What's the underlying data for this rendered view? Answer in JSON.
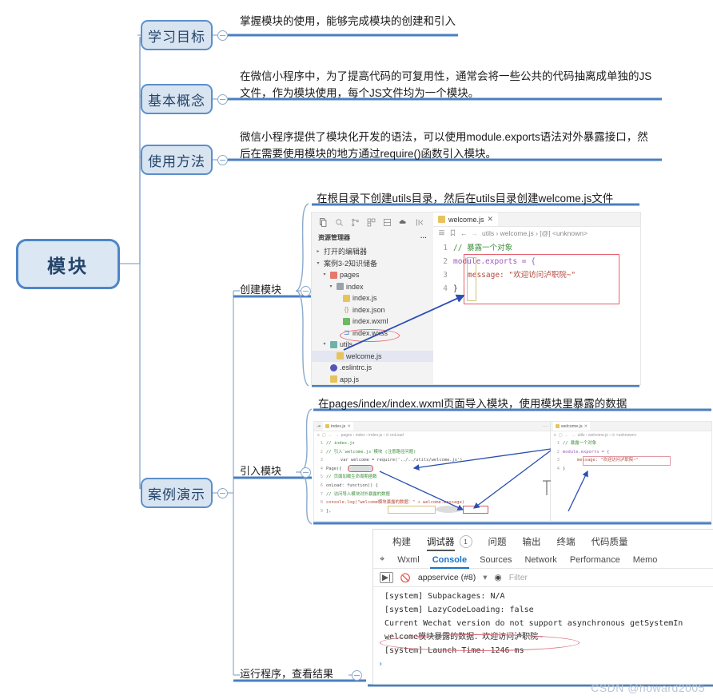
{
  "root": {
    "label": "模块"
  },
  "branches": [
    {
      "name": "学习目标",
      "text": "掌握模块的使用，能够完成模块的创建和引入"
    },
    {
      "name": "基本概念",
      "text": "在微信小程序中，为了提高代码的可复用性，通常会将一些公共的代码抽离成单独的JS\n文件，作为模块使用，每个JS文件均为一个模块。"
    },
    {
      "name": "使用方法",
      "text": "微信小程序提供了模块化开发的语法，可以使用module.exports语法对外暴露接口，然\n后在需要使用模块的地方通过require()函数引入模块。"
    },
    {
      "name": "案例演示",
      "text": ""
    }
  ],
  "case_children": [
    {
      "label": "创建模块",
      "caption": "在根目录下创建utils目录，然后在utils目录创建welcome.js文件"
    },
    {
      "label": "引入模块",
      "caption": "在pages/index/index.wxml页面导入模块，使用模块里暴露的数据"
    },
    {
      "label": "运行程序，查看结果",
      "caption": ""
    }
  ],
  "shot_create_module": {
    "explorer_title": "资源管理器",
    "explorer_more": "···",
    "tree": [
      {
        "label": "打开的编辑器",
        "depth": 0,
        "caret": "▸",
        "icon": "none"
      },
      {
        "label": "案例3-2知识储备",
        "depth": 0,
        "caret": "▾",
        "icon": "none"
      },
      {
        "label": "pages",
        "depth": 1,
        "caret": "▾",
        "icon": "folder-red"
      },
      {
        "label": "index",
        "depth": 2,
        "caret": "▾",
        "icon": "folder-gray"
      },
      {
        "label": "index.js",
        "depth": 3,
        "caret": "",
        "icon": "js"
      },
      {
        "label": "index.json",
        "depth": 3,
        "caret": "",
        "icon": "json"
      },
      {
        "label": "index.wxml",
        "depth": 3,
        "caret": "",
        "icon": "wxml"
      },
      {
        "label": "index.wxss",
        "depth": 3,
        "caret": "",
        "icon": "wxss"
      },
      {
        "label": "utils",
        "depth": 1,
        "caret": "▾",
        "icon": "folder-teal"
      },
      {
        "label": "welcome.js",
        "depth": 2,
        "caret": "",
        "icon": "js",
        "selected": true
      },
      {
        "label": ".eslintrc.js",
        "depth": 1,
        "caret": "",
        "icon": "eslint"
      },
      {
        "label": "app.js",
        "depth": 1,
        "caret": "",
        "icon": "app"
      }
    ],
    "tab_label": "welcome.js",
    "tab_close": "✕",
    "breadcrumb": "utils  ›  welcome.js  ›  [@] <unknown>",
    "breadcrumb_parts": [
      "utils",
      "welcome.js",
      "[⊙]",
      "<unknown>"
    ],
    "code": [
      {
        "num": "1",
        "text": "// 暴露一个对象"
      },
      {
        "num": "2",
        "text": "module.exports = {"
      },
      {
        "num": "3",
        "text": "message: \"欢迎访问泸职院~\""
      },
      {
        "num": "4",
        "text": "}"
      }
    ]
  },
  "shot_import_module": {
    "left": {
      "tab_label": "index.js",
      "breadcrumb": "pages › index › index.js › ⊙ onLoad",
      "code": [
        {
          "num": "1",
          "text": "// index.js"
        },
        {
          "num": "2",
          "text": "// 引入`welcome.js`模块 (注意路径问题)"
        },
        {
          "num": "3",
          "text": "var welcome = require('../../utils/welcome.js')"
        },
        {
          "num": "4",
          "text": "Page({"
        },
        {
          "num": "5",
          "text": "// 页面加载生命周期函数"
        },
        {
          "num": "6",
          "text": "onLoad: function() {"
        },
        {
          "num": "7",
          "text": "// 访问导入模块对外暴露的数据"
        },
        {
          "num": "8",
          "text": "console.log(\"welcome模块暴露的数据：\" + welcome.message)"
        },
        {
          "num": "9",
          "text": "},"
        }
      ]
    },
    "right": {
      "tab_label": "welcome.js",
      "breadcrumb": "utils › welcome.js › ⊙ <unknown>",
      "code": [
        {
          "num": "1",
          "text": "// 暴露一个对象"
        },
        {
          "num": "2",
          "text": "module.exports = {"
        },
        {
          "num": "3",
          "text": "message: \"欢迎访问泸职院~\""
        },
        {
          "num": "4",
          "text": "}"
        }
      ]
    }
  },
  "devtools": {
    "top_tabs": [
      {
        "label": "构建",
        "active": false
      },
      {
        "label": "调试器",
        "active": true,
        "badge": "1"
      },
      {
        "label": "问题",
        "active": false
      },
      {
        "label": "输出",
        "active": false
      },
      {
        "label": "终端",
        "active": false
      },
      {
        "label": "代码质量",
        "active": false
      }
    ],
    "panel_tabs": [
      {
        "label": "Wxml",
        "active": false
      },
      {
        "label": "Console",
        "active": true
      },
      {
        "label": "Sources",
        "active": false
      },
      {
        "label": "Network",
        "active": false
      },
      {
        "label": "Performance",
        "active": false
      },
      {
        "label": "Memo",
        "active": false
      }
    ],
    "context": "appservice (#8)",
    "filter_placeholder": "Filter",
    "console_lines": [
      {
        "text": "[system] Subpackages: N/A",
        "highlight": false
      },
      {
        "text": "[system] LazyCodeLoading: false",
        "highlight": false
      },
      {
        "text": "Current Wechat version do not support asynchronous getSystemIn",
        "highlight": false
      },
      {
        "text": "welcome模块暴露的数据：欢迎访问泸职院~",
        "highlight": true
      },
      {
        "text": "[system] Launch Time: 1246 ms",
        "highlight": false
      }
    ],
    "prompt": "›"
  },
  "watermark": "CSDN @howard2005",
  "colors": {
    "node_fill": "#d9e4f1",
    "node_border": "#5b8fcb",
    "branch_line": "#4a7fc1",
    "thin_line": "#8aa9cc",
    "accent_red": "#e06a78",
    "arrow_blue": "#2b4fb0"
  }
}
